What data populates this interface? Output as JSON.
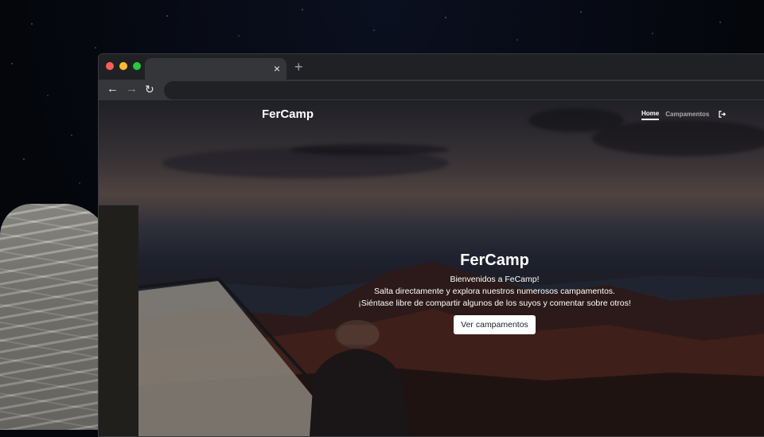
{
  "browser": {
    "tab_close_glyph": "×",
    "new_tab_glyph": "+",
    "back_glyph": "←",
    "forward_glyph": "→",
    "reload_glyph": "↻"
  },
  "navbar": {
    "brand": "FerCamp",
    "links": [
      {
        "label": "Home",
        "active": true
      },
      {
        "label": "Campamentos",
        "active": false
      }
    ],
    "logout_icon": "logout-icon"
  },
  "hero": {
    "title": "FerCamp",
    "lines": [
      "Bienvenidos a FeCamp!",
      "Salta directamente y explora nuestros numerosos campamentos.",
      "¡Siéntase libre de compartir algunos de los suyos y comentar sobre otros!"
    ],
    "button_label": "Ver campamentos"
  },
  "colors": {
    "traffic_red": "#ff5f57",
    "traffic_yellow": "#febc2e",
    "traffic_green": "#28c840",
    "chrome_dark": "#202124",
    "chrome_toolbar": "#35363a"
  }
}
